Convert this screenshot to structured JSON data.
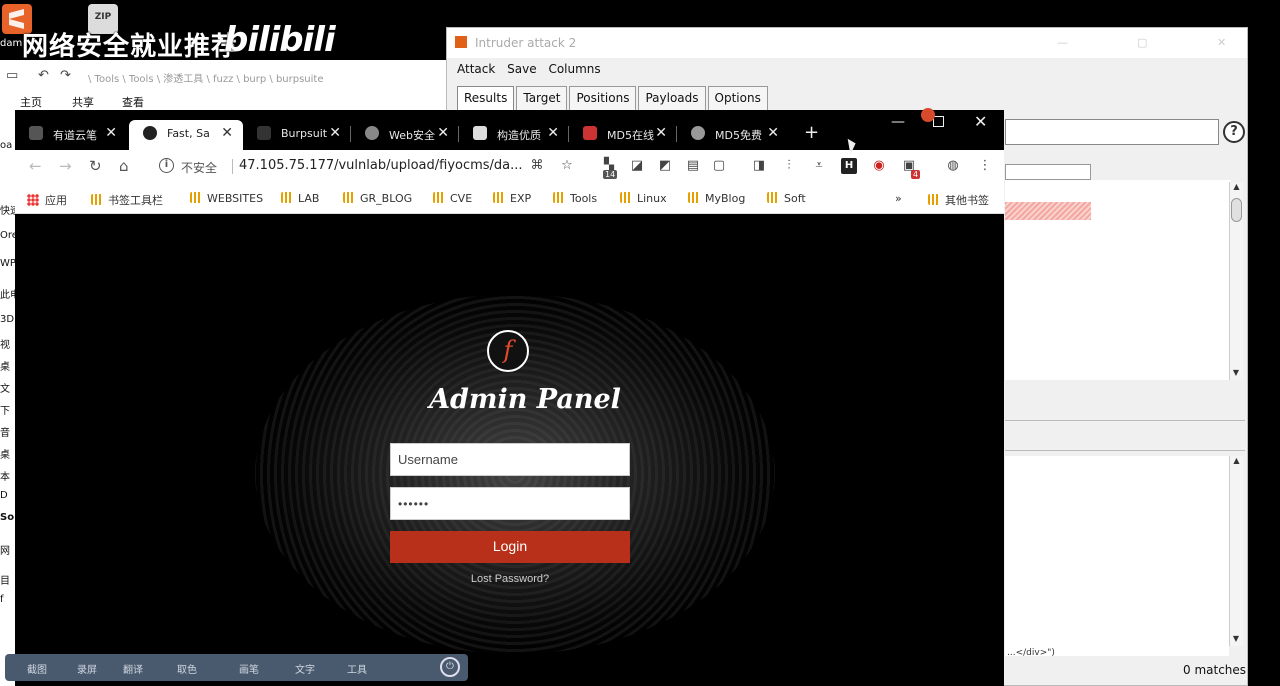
{
  "desktop": {
    "watermark": "网络安全就业推荐",
    "bilibili": "bilibili",
    "icon_label": "dam",
    "zip_label": "ZIP"
  },
  "explorer": {
    "address": "\\ Tools \\ Tools \\ 渗透工具 \\ fuzz \\ burp \\ burpsuite",
    "ribbon": [
      "主页",
      "共享",
      "查看"
    ],
    "side_items": [
      "oa",
      "快速",
      "Ore",
      "WP",
      "此电",
      "3D",
      "视",
      "桌",
      "文",
      "下",
      "音",
      "桌",
      "本",
      "D",
      "So",
      "网",
      "目",
      "f"
    ]
  },
  "burp": {
    "title": "Intruder attack 2",
    "menu": [
      "Attack",
      "Save",
      "Columns"
    ],
    "tabs": [
      "Results",
      "Target",
      "Positions",
      "Payloads",
      "Options"
    ],
    "help": "?",
    "snippet": "...</div>\")",
    "matches": "0 matches"
  },
  "chrome": {
    "tabs": [
      {
        "label": "有道云笔",
        "close": "✕"
      },
      {
        "label": "Fast, Sa",
        "close": "✕"
      },
      {
        "label": "Burpsuit",
        "close": "✕"
      },
      {
        "label": "Web安全",
        "close": "✕"
      },
      {
        "label": "构造优质",
        "close": "✕"
      },
      {
        "label": "MD5在线",
        "close": "✕"
      },
      {
        "label": "MD5免费",
        "close": "✕"
      }
    ],
    "new_tab": "+",
    "insecure": "不安全",
    "url": "47.105.75.177/vulnlab/upload/fiyocms/da...",
    "badge_14": "14",
    "badge_4": "4",
    "bookmarks": [
      "应用",
      "书签工具栏",
      "WEBSITES",
      "LAB",
      "GR_BLOG",
      "CVE",
      "EXP",
      "Tools",
      "Linux",
      "MyBlog",
      "Soft"
    ],
    "more": "»",
    "other_bookmarks": "其他书签"
  },
  "login": {
    "logo_letter": "f",
    "title": "Admin Panel",
    "username_placeholder": "Username",
    "password_value": "••••••",
    "button": "Login",
    "lost_password": "Lost Password?"
  },
  "float_bar": {
    "items": [
      "截图",
      "录屏",
      "翻译",
      "取色",
      "画笔",
      "文字",
      "工具"
    ],
    "power": "⏻"
  }
}
